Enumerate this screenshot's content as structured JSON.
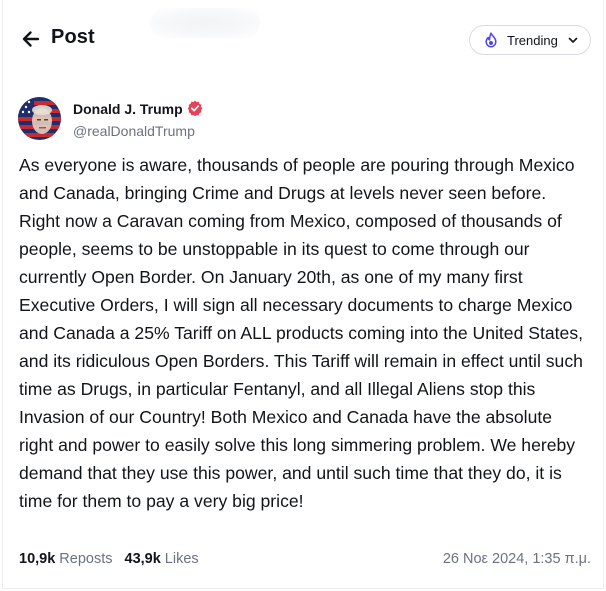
{
  "header": {
    "title": "Post",
    "back_icon": "arrow-left-icon",
    "trending": {
      "label": "Trending",
      "icon": "fire-icon",
      "chevron": "chevron-down-icon",
      "accent": "#4f46e5"
    }
  },
  "post": {
    "author": {
      "name": "Donald J. Trump",
      "handle": "@realDonaldTrump",
      "verified_color": "#e8425b"
    },
    "text": "As everyone is aware, thousands of people are pouring through Mexico and Canada, bringing Crime and Drugs at levels never seen before. Right now a Caravan coming from Mexico, composed of thousands of people, seems to be unstoppable in its quest to come through our currently Open Border. On January 20th, as one of my many first Executive Orders, I will sign all necessary documents to charge Mexico and Canada a 25% Tariff on ALL products coming into the United States, and its ridiculous Open Borders. This Tariff will remain in effect until such time as Drugs, in particular Fentanyl, and all Illegal Aliens stop this Invasion of our Country! Both Mexico and Canada have the absolute right and power to easily solve this long simmering problem. We hereby demand that they use this power, and until such time that they do, it is time for them to pay a very big price!",
    "stats": {
      "reposts_count": "10,9k",
      "reposts_label": "Reposts",
      "likes_count": "43,9k",
      "likes_label": "Likes"
    },
    "timestamp": "26 Νοε 2024, 1:35 π.μ."
  }
}
